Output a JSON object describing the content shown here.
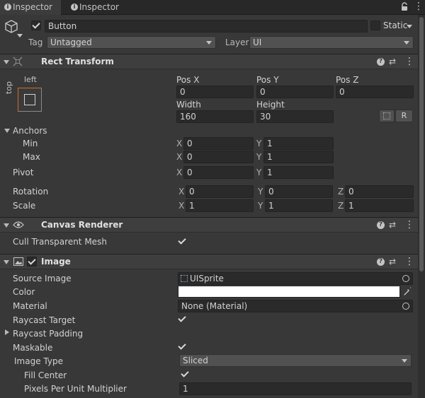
{
  "tabs": [
    {
      "label": "Inspector",
      "active": true
    },
    {
      "label": "Inspector",
      "active": false
    }
  ],
  "gameobject": {
    "name": "Button",
    "static_label": "Static",
    "tag_label": "Tag",
    "tag_value": "Untagged",
    "layer_label": "Layer",
    "layer_value": "UI"
  },
  "rect_transform": {
    "title": "Rect Transform",
    "anchor_preset_h": "left",
    "anchor_preset_v": "top",
    "pos_x_label": "Pos X",
    "pos_y_label": "Pos Y",
    "pos_z_label": "Pos Z",
    "pos_x": "0",
    "pos_y": "0",
    "pos_z": "0",
    "width_label": "Width",
    "height_label": "Height",
    "width": "160",
    "height": "30",
    "r_button": "R",
    "anchors_label": "Anchors",
    "min_label": "Min",
    "max_label": "Max",
    "min_x": "0",
    "min_y": "1",
    "max_x": "0",
    "max_y": "1",
    "pivot_label": "Pivot",
    "pivot_x": "0",
    "pivot_y": "1",
    "rotation_label": "Rotation",
    "rot_x": "0",
    "rot_y": "0",
    "rot_z": "0",
    "scale_label": "Scale",
    "scale_x": "1",
    "scale_y": "1",
    "scale_z": "1",
    "x": "X",
    "y": "Y",
    "z": "Z"
  },
  "canvas_renderer": {
    "title": "Canvas Renderer",
    "cull_label": "Cull Transparent Mesh"
  },
  "image": {
    "title": "Image",
    "source_label": "Source Image",
    "source_value": "UISprite",
    "color_label": "Color",
    "color_value": "#ffffff",
    "material_label": "Material",
    "material_value": "None (Material)",
    "raycast_target_label": "Raycast Target",
    "raycast_padding_label": "Raycast Padding",
    "maskable_label": "Maskable",
    "image_type_label": "Image Type",
    "image_type_value": "Sliced",
    "fill_center_label": "Fill Center",
    "ppu_label": "Pixels Per Unit Multiplier",
    "ppu_value": "1"
  }
}
